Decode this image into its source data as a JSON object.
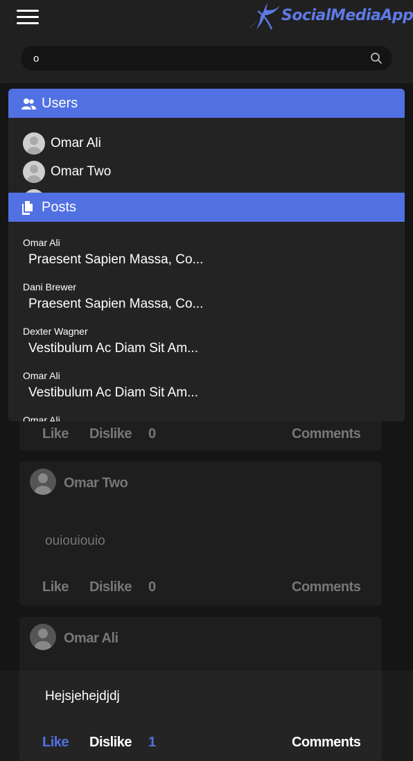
{
  "app": {
    "logo_text": "SocialMediaApp"
  },
  "search": {
    "value": "o",
    "placeholder": ""
  },
  "dropdown": {
    "users_header": "Users",
    "posts_header": "Posts",
    "users": [
      {
        "name": "Omar Ali"
      },
      {
        "name": "Omar Two"
      }
    ],
    "posts": [
      {
        "author": "Omar Ali",
        "title": "Praesent Sapien Massa, Co..."
      },
      {
        "author": "Dani Brewer",
        "title": "Praesent Sapien Massa, Co..."
      },
      {
        "author": "Dexter Wagner",
        "title": "Vestibulum Ac Diam Sit Am..."
      },
      {
        "author": "Omar Ali",
        "title": "Vestibulum Ac Diam Sit Am..."
      },
      {
        "author": "Omar Ali",
        "title": ""
      }
    ]
  },
  "feed": {
    "posts": [
      {
        "author": "",
        "content": "",
        "like": "Like",
        "dislike": "Dislike",
        "count": "0",
        "comments": "Comments"
      },
      {
        "author": "Omar Two",
        "content": "ouiouiouio",
        "like": "Like",
        "dislike": "Dislike",
        "count": "0",
        "comments": "Comments"
      },
      {
        "author": "Omar Ali",
        "content": "Hejsjehejdjdj",
        "like": "Like",
        "dislike": "Dislike",
        "count": "1",
        "comments": "Comments"
      }
    ]
  },
  "colors": {
    "accent": "#5171e3",
    "like_active": "#5171e3",
    "header_bg": "#202020",
    "card_bg": "#242424"
  }
}
